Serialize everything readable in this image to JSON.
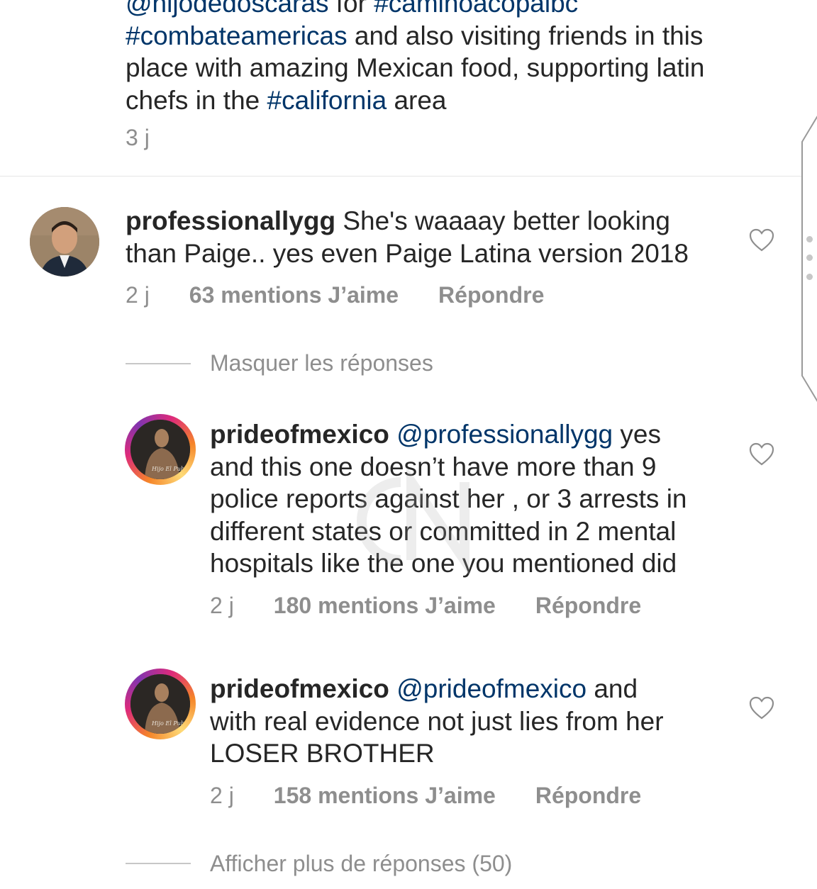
{
  "caption": {
    "line0": {
      "user": "@hijodedoscaras",
      "mid": " for ",
      "tag": "#caminoacopalbc"
    },
    "line1": {
      "tag": "#combateamericas",
      "rest": " and also visiting friends in this"
    },
    "line2": "place with amazing Mexican food, supporting latin",
    "line3": {
      "pre": "chefs in the ",
      "tag": "#california",
      "post": " area"
    },
    "time": "3 j"
  },
  "comments": [
    {
      "username": "professionallygg",
      "text_line1": " She's waaaay better looking",
      "text_line2": "than Paige.. yes even Paige Latina version 2018",
      "time": "2 j",
      "likes": "63 mentions J’aime",
      "reply": "Répondre"
    }
  ],
  "hide_replies": "Masquer les réponses",
  "replies": [
    {
      "username": "prideofmexico",
      "mention": "@professionallygg",
      "lines": [
        " yes",
        "and this one doesn’t have more than 9",
        "police reports against her , or 3 arrests in",
        "different states or committed in 2 mental",
        "hospitals like the one you mentioned did"
      ],
      "time": "2 j",
      "likes": "180 mentions J’aime",
      "reply": "Répondre"
    },
    {
      "username": "prideofmexico",
      "mention": "@prideofmexico",
      "lines": [
        " and",
        "with real evidence not just lies from her",
        "LOSER BROTHER"
      ],
      "time": "2 j",
      "likes": "158 mentions J’aime",
      "reply": "Répondre"
    }
  ],
  "more_replies": "Afficher plus de réponses (50)",
  "colors": {
    "link": "#003569",
    "text": "#262626",
    "muted": "#8e8e8e"
  },
  "icons": [
    "heart-icon",
    "avatar"
  ]
}
